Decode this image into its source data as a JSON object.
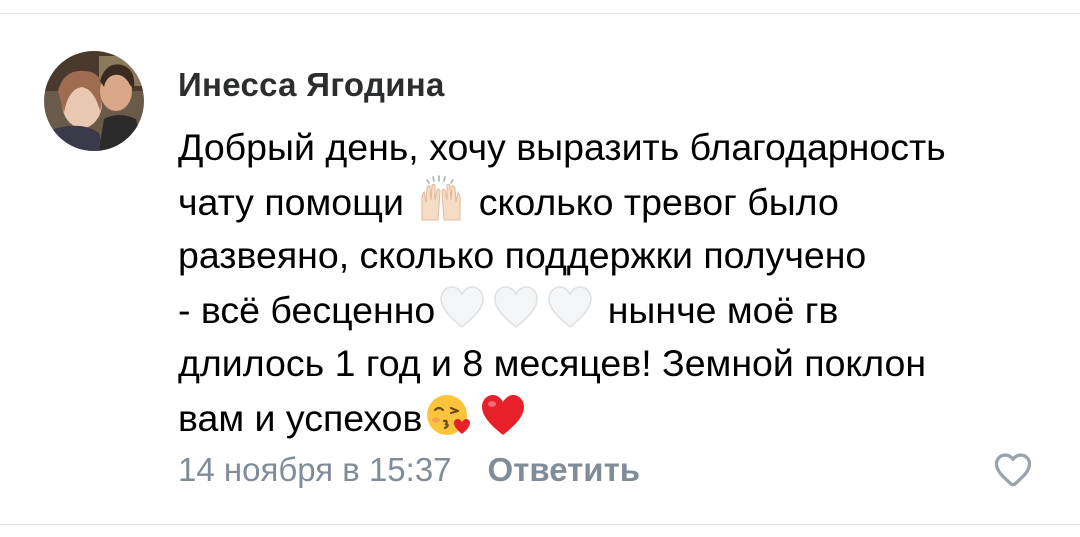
{
  "comment": {
    "author": "Инесса Ягодина",
    "lines": [
      [
        "Добрый день, хочу выразить благодарность"
      ],
      [
        "чату помощи ",
        "raising-hands-emoji",
        " сколько тревог было"
      ],
      [
        "развеяно, сколько поддержки получено"
      ],
      [
        "- всё бесценно",
        "white-heart-emoji",
        "white-heart-emoji",
        "white-heart-emoji",
        " нынче моё гв"
      ],
      [
        "длилось 1 год и 8 месяцев! Земной поклон"
      ],
      [
        "вам и успехов",
        "kissing-face-emoji",
        "red-heart-emoji"
      ]
    ],
    "timestamp": "14 ноября в 15:37",
    "reply_label": "Ответить"
  },
  "colors": {
    "author": "#2c2d2e",
    "secondary_text": "#818c99",
    "divider": "#e1e3e6"
  },
  "icons": {
    "like": "heart-outline-icon"
  }
}
